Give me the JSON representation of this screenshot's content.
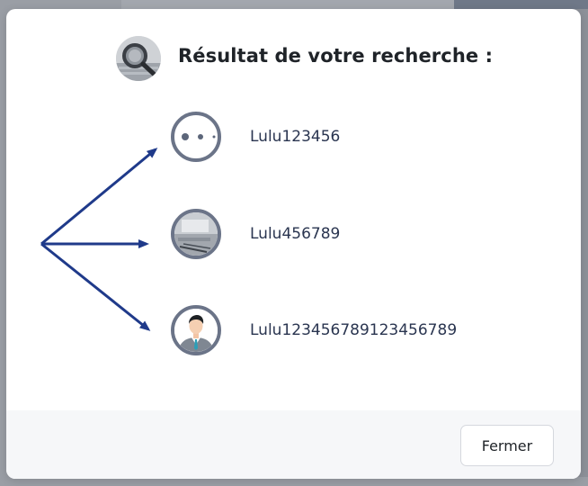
{
  "modal": {
    "title": "Résultat de votre recherche :",
    "header_icon": "magnifier-photo-icon",
    "results": [
      {
        "username": "Lulu123456",
        "avatar": "dots-avatar-icon"
      },
      {
        "username": "Lulu456789",
        "avatar": "desk-photo-avatar-icon"
      },
      {
        "username": "Lulu123456789123456789",
        "avatar": "businessman-avatar-icon"
      }
    ],
    "close_label": "Fermer"
  },
  "colors": {
    "arrow": "#1f3a8a",
    "avatar_ring": "#6b7488",
    "overlay": "#8d9199",
    "footer_bg": "#f6f7f9"
  }
}
